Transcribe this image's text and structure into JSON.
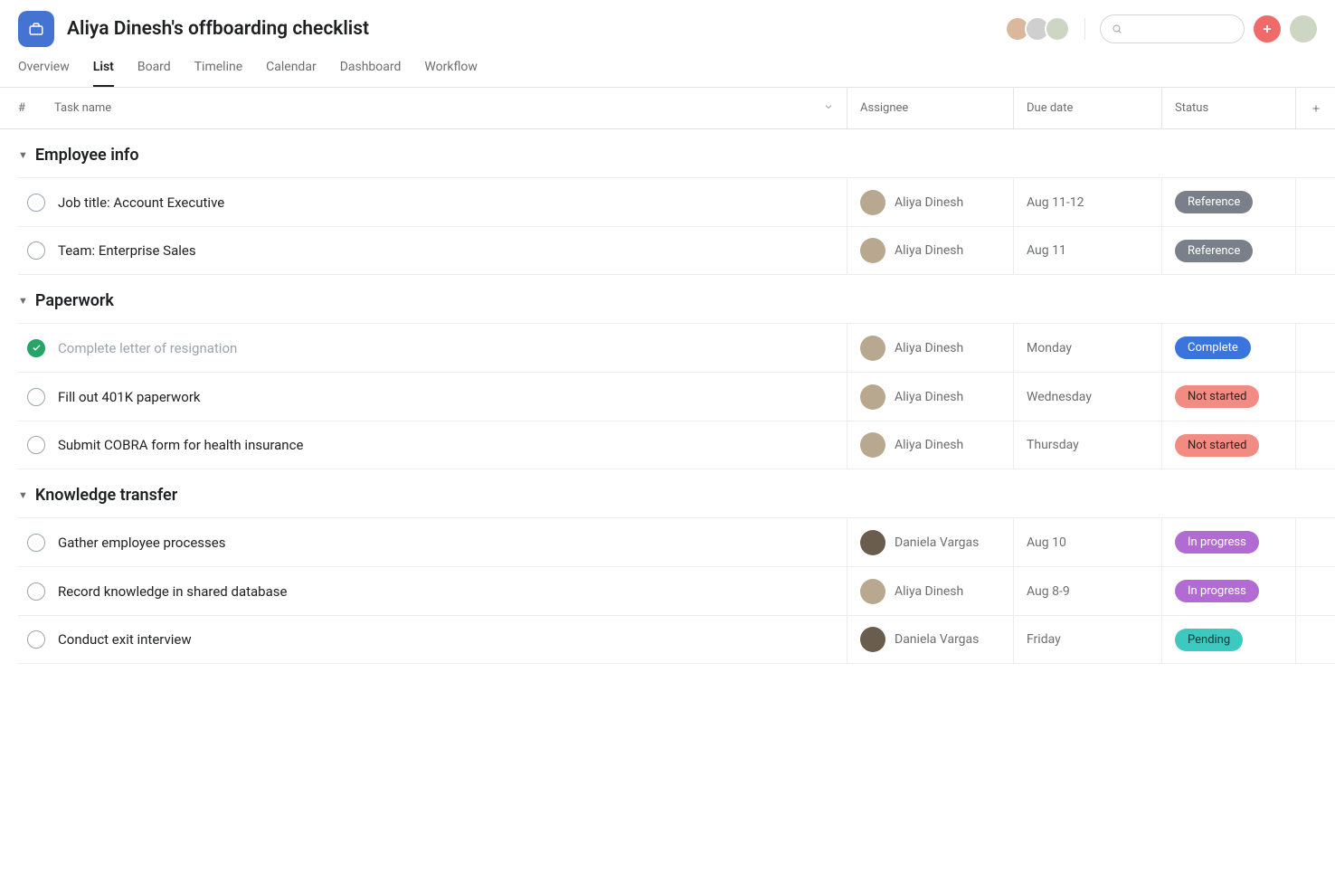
{
  "project": {
    "title": "Aliya Dinesh's offboarding checklist"
  },
  "tabs": [
    {
      "label": "Overview",
      "active": false
    },
    {
      "label": "List",
      "active": true
    },
    {
      "label": "Board",
      "active": false
    },
    {
      "label": "Timeline",
      "active": false
    },
    {
      "label": "Calendar",
      "active": false
    },
    {
      "label": "Dashboard",
      "active": false
    },
    {
      "label": "Workflow",
      "active": false
    }
  ],
  "columns": {
    "num": "#",
    "name": "Task name",
    "assignee": "Assignee",
    "due": "Due date",
    "status": "Status"
  },
  "statusColors": {
    "Reference": {
      "bg": "#7a8089",
      "fg": "#ffffff"
    },
    "Complete": {
      "bg": "#3a74dd",
      "fg": "#ffffff"
    },
    "Not started": {
      "bg": "#f28b82",
      "fg": "#3a2020"
    },
    "In progress": {
      "bg": "#b36bd4",
      "fg": "#ffffff"
    },
    "Pending": {
      "bg": "#3bc9c0",
      "fg": "#0e3d39"
    }
  },
  "sections": [
    {
      "name": "Employee info",
      "tasks": [
        {
          "done": false,
          "name": "Job title: Account Executive",
          "assignee": "Aliya Dinesh",
          "due": "Aug 11-12",
          "status": "Reference"
        },
        {
          "done": false,
          "name": "Team: Enterprise Sales",
          "assignee": "Aliya Dinesh",
          "due": "Aug 11",
          "status": "Reference"
        }
      ]
    },
    {
      "name": "Paperwork",
      "tasks": [
        {
          "done": true,
          "name": "Complete letter of resignation",
          "assignee": "Aliya Dinesh",
          "due": "Monday",
          "status": "Complete"
        },
        {
          "done": false,
          "name": "Fill out 401K paperwork",
          "assignee": "Aliya Dinesh",
          "due": "Wednesday",
          "status": "Not started"
        },
        {
          "done": false,
          "name": "Submit COBRA form for health insurance",
          "assignee": "Aliya Dinesh",
          "due": "Thursday",
          "status": "Not started"
        }
      ]
    },
    {
      "name": "Knowledge transfer",
      "tasks": [
        {
          "done": false,
          "name": "Gather employee processes",
          "assignee": "Daniela Vargas",
          "due": "Aug 10",
          "status": "In progress"
        },
        {
          "done": false,
          "name": "Record knowledge in shared database",
          "assignee": "Aliya Dinesh",
          "due": "Aug 8-9",
          "status": "In progress"
        },
        {
          "done": false,
          "name": "Conduct exit interview",
          "assignee": "Daniela Vargas",
          "due": "Friday",
          "status": "Pending"
        }
      ]
    }
  ]
}
